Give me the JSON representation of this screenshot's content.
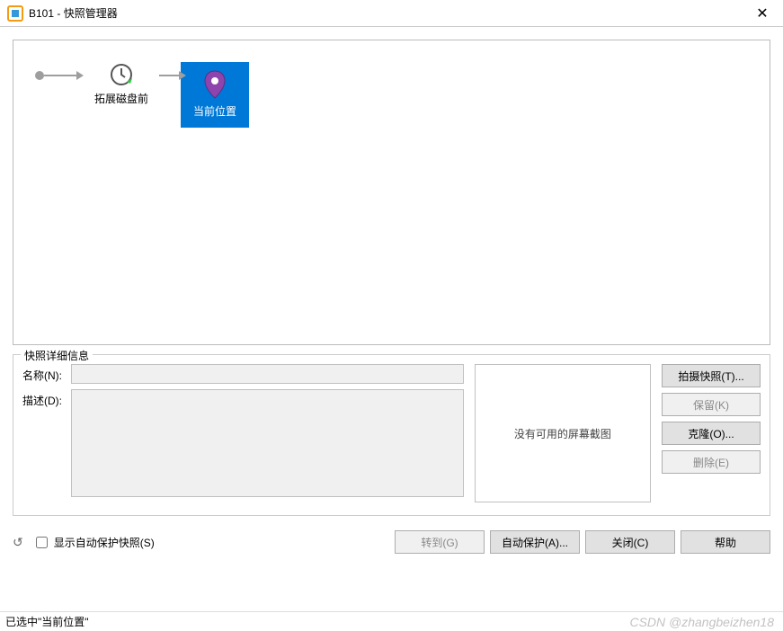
{
  "window": {
    "title": "B101 - 快照管理器"
  },
  "tree": {
    "snapshot_label": "拓展磁盘前",
    "current_label": "当前位置"
  },
  "details": {
    "legend": "快照详细信息",
    "name_label": "名称(N):",
    "desc_label": "描述(D):",
    "name_value": "",
    "desc_value": "",
    "preview_text": "没有可用的屏幕截图"
  },
  "side_buttons": {
    "take": "拍摄快照(T)...",
    "keep": "保留(K)",
    "clone": "克隆(O)...",
    "delete": "删除(E)"
  },
  "bottom": {
    "auto_protect_checkbox": "显示自动保护快照(S)",
    "goto": "转到(G)",
    "auto_protect_btn": "自动保护(A)...",
    "close": "关闭(C)",
    "help": "帮助"
  },
  "status": {
    "text": "已选中\"当前位置\""
  },
  "watermark": "CSDN @zhangbeizhen18"
}
